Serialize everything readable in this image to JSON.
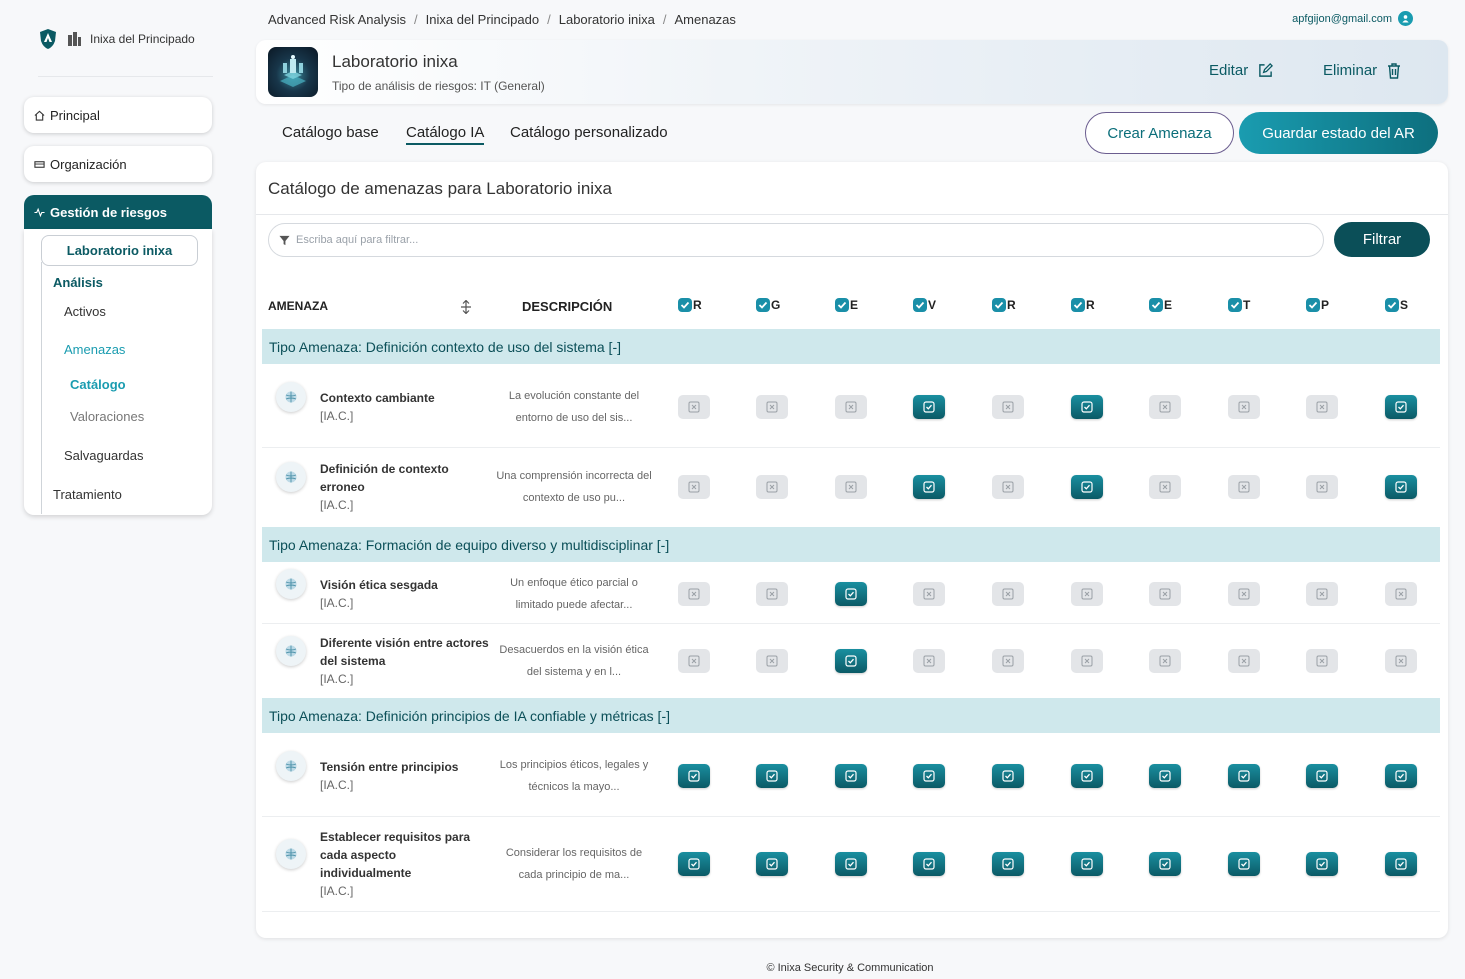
{
  "sidebar": {
    "brand": "Inixa del Principado",
    "items": [
      {
        "label": "Principal"
      },
      {
        "label": "Organización"
      },
      {
        "label": "Gestión de riesgos"
      }
    ],
    "project": "Laboratorio inixa",
    "analysis": "Análisis",
    "activos": "Activos",
    "amenazas": "Amenazas",
    "catalogo": "Catálogo",
    "valoraciones": "Valoraciones",
    "salvaguardas": "Salvaguardas",
    "tratamiento": "Tratamiento"
  },
  "breadcrumb": [
    "Advanced Risk Analysis",
    "Inixa del Principado",
    "Laboratorio inixa",
    "Amenazas"
  ],
  "user": {
    "email": "apfgijon@gmail.com"
  },
  "header": {
    "title": "Laboratorio inixa",
    "subtitle": "Tipo de análisis de riesgos: IT (General)",
    "edit_label": "Editar",
    "delete_label": "Eliminar"
  },
  "tabs": [
    {
      "label": "Catálogo base"
    },
    {
      "label": "Catálogo IA"
    },
    {
      "label": "Catálogo personalizado"
    }
  ],
  "actions": {
    "create": "Crear Amenaza",
    "save": "Guardar estado del AR"
  },
  "card": {
    "title": "Catálogo de amenazas para Laboratorio inixa",
    "filter_placeholder": "Escriba aquí para filtrar...",
    "filter_button": "Filtrar"
  },
  "table": {
    "col_threat": "AMENAZA",
    "col_desc": "DESCRIPCIÓN",
    "check_columns": [
      "R",
      "G",
      "E",
      "V",
      "R",
      "R",
      "E",
      "T",
      "P",
      "S"
    ],
    "groups": [
      {
        "label": "Tipo Amenaza: Definición contexto de uso del sistema [-]",
        "rows": [
          {
            "name": "Contexto cambiante",
            "code": "[IA.C.]",
            "desc": "La evolución constante del entorno de uso del sis...",
            "flags": [
              0,
              0,
              0,
              1,
              0,
              1,
              0,
              0,
              0,
              1
            ]
          },
          {
            "name": "Definición de contexto erroneo",
            "code": "[IA.C.]",
            "desc": "Una comprensión incorrecta del contexto de uso pu...",
            "flags": [
              0,
              0,
              0,
              1,
              0,
              1,
              0,
              0,
              0,
              1
            ]
          }
        ]
      },
      {
        "label": "Tipo Amenaza: Formación de equipo diverso y multidisciplinar [-]",
        "rows": [
          {
            "name": "Visión ética sesgada",
            "code": "[IA.C.]",
            "desc": "Un enfoque ético parcial o limitado puede afectar...",
            "flags": [
              0,
              0,
              1,
              0,
              0,
              0,
              0,
              0,
              0,
              0
            ]
          },
          {
            "name": "Diferente visión entre actores del sistema",
            "code": "[IA.C.]",
            "desc": "Desacuerdos en la visión ética del sistema y en l...",
            "flags": [
              0,
              0,
              1,
              0,
              0,
              0,
              0,
              0,
              0,
              0
            ]
          }
        ]
      },
      {
        "label": "Tipo Amenaza: Definición principios de IA confiable y métricas [-]",
        "rows": [
          {
            "name": "Tensión entre principios",
            "code": "[IA.C.]",
            "desc": "Los principios éticos, legales y técnicos la mayo...",
            "flags": [
              1,
              1,
              1,
              1,
              1,
              1,
              1,
              1,
              1,
              1
            ]
          },
          {
            "name": "Establecer requisitos para cada aspecto individualmente",
            "code": "[IA.C.]",
            "desc": "Considerar los requisitos de cada principio de ma...",
            "flags": [
              1,
              1,
              1,
              1,
              1,
              1,
              1,
              1,
              1,
              1
            ]
          }
        ]
      }
    ]
  },
  "footer": "© Inixa Security & Communication"
}
